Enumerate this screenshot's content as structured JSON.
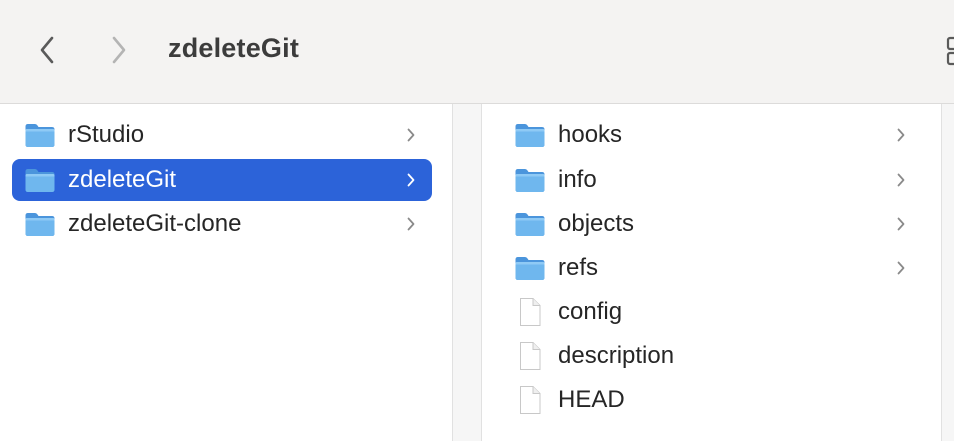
{
  "toolbar": {
    "title": "zdeleteGit",
    "back_icon": "chevron-left-icon",
    "forward_icon": "chevron-right-icon",
    "view_icon": "grid-view-icon"
  },
  "column1": {
    "items": [
      {
        "label": "rStudio",
        "type": "folder",
        "selected": false
      },
      {
        "label": "zdeleteGit",
        "type": "folder",
        "selected": true
      },
      {
        "label": "zdeleteGit-clone",
        "type": "folder",
        "selected": false
      }
    ]
  },
  "column2": {
    "items": [
      {
        "label": "hooks",
        "type": "folder"
      },
      {
        "label": "info",
        "type": "folder"
      },
      {
        "label": "objects",
        "type": "folder"
      },
      {
        "label": "refs",
        "type": "folder"
      },
      {
        "label": "config",
        "type": "file"
      },
      {
        "label": "description",
        "type": "file"
      },
      {
        "label": "HEAD",
        "type": "file"
      }
    ]
  },
  "colors": {
    "selection": "#2c63d9",
    "folder": "#5aa7e6",
    "toolbar_bg": "#f4f3f2"
  }
}
